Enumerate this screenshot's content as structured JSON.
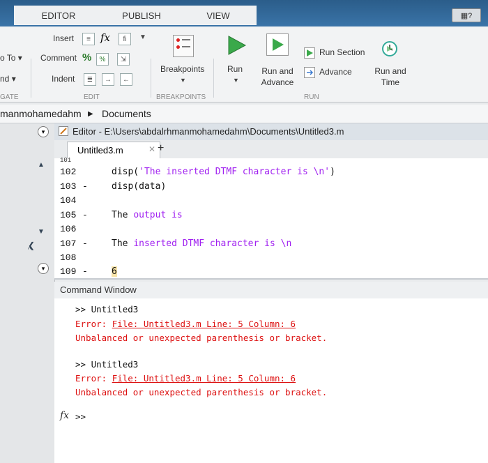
{
  "tabs": [
    {
      "label": "EDITOR"
    },
    {
      "label": "PUBLISH"
    },
    {
      "label": "VIEW"
    }
  ],
  "toolstrip": {
    "left_partial": [
      "o To",
      "nd",
      "GATE"
    ],
    "edit": {
      "insert": "Insert",
      "fx": "fx",
      "comment": "Comment",
      "indent": "Indent",
      "section": "EDIT"
    },
    "breakpoints": {
      "label": "Breakpoints",
      "section": "BREAKPOINTS"
    },
    "run": {
      "run": "Run",
      "run_advance_1": "Run and",
      "run_advance_2": "Advance",
      "run_section": "Run Section",
      "advance": "Advance",
      "run_time_1": "Run and",
      "run_time_2": "Time",
      "section": "RUN"
    }
  },
  "breadcrumb": {
    "part1": "manmohamedahm",
    "part2": "Documents"
  },
  "editor": {
    "title": "Editor - E:\\Users\\abdalrhmanmohamedahm\\Documents\\Untitled3.m",
    "file_tab": "Untitled3.m",
    "lines": [
      {
        "num": "102",
        "dash": "",
        "text": "disp('The inserted DTMF character is \\n')"
      },
      {
        "num": "103",
        "dash": "-",
        "text": "disp(data)"
      },
      {
        "num": "104",
        "dash": "",
        "text": ""
      },
      {
        "num": "105",
        "dash": "-",
        "text": "The output is"
      },
      {
        "num": "106",
        "dash": "",
        "text": ""
      },
      {
        "num": "107",
        "dash": "-",
        "text": "The inserted DTMF character is \\n"
      },
      {
        "num": "108",
        "dash": "",
        "text": ""
      },
      {
        "num": "109",
        "dash": "-",
        "text": "6"
      }
    ]
  },
  "command_window": {
    "title": "Command Window",
    "blocks": [
      {
        "cmd": ">> Untitled3",
        "err_prefix": "Error: ",
        "err_link": "File: Untitled3.m Line: 5 Column: 6",
        "msg": "Unbalanced or unexpected parenthesis or bracket."
      },
      {
        "cmd": ">> Untitled3",
        "err_prefix": "Error: ",
        "err_link": "File: Untitled3.m Line: 5 Column: 6",
        "msg": "Unbalanced or unexpected parenthesis or bracket."
      }
    ],
    "prompt": ">>",
    "fx": "fx"
  }
}
